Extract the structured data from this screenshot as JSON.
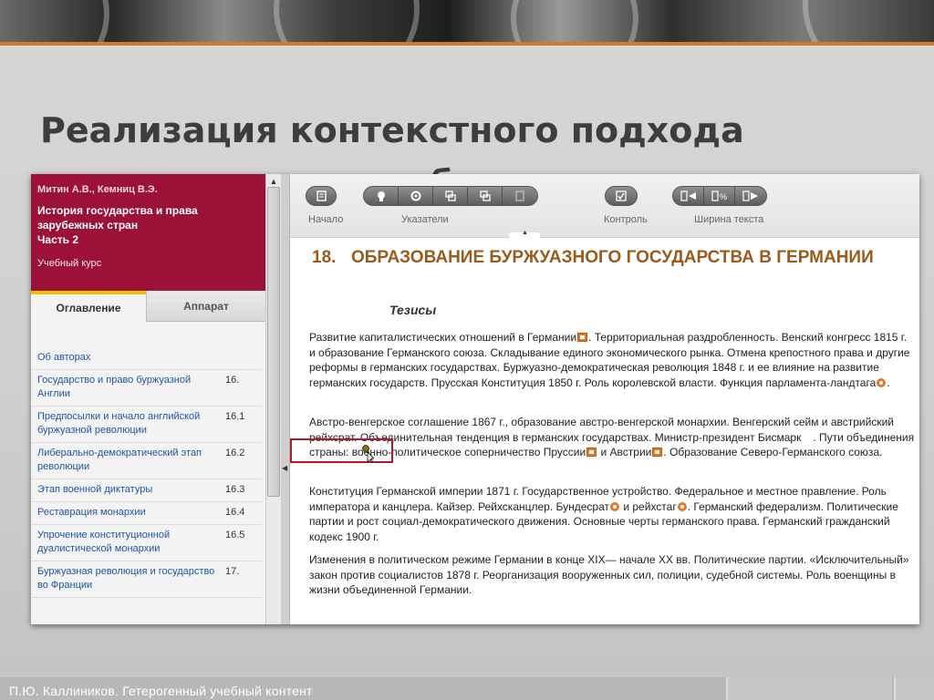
{
  "slide": {
    "title_line1": "Реализация контекстного подхода",
    "title_line2": "в электронных учебных курсах",
    "footer": "П.Ю. Каллиников. Гетерогенный учебный контент"
  },
  "course": {
    "authors": "Митин А.В., Кемниц В.Э.",
    "title_line1": "История государства и права",
    "title_line2": "зарубежных стран",
    "title_line3": "Часть 2",
    "kind": "Учебный курс",
    "accent_color": "#9b1137"
  },
  "tabs": {
    "contents": "Оглавление",
    "apparatus": "Аппарат"
  },
  "toc": [
    {
      "label": "Об авторах",
      "num": ""
    },
    {
      "label": "Государство и право буржуазной Англии",
      "num": "16."
    },
    {
      "label": "Предпосылки и начало английской буржуазной революции",
      "num": "16.1"
    },
    {
      "label": "Либерально-демократический этап революции",
      "num": "16.2"
    },
    {
      "label": "Этап военной диктатуры",
      "num": "16.3"
    },
    {
      "label": "Реставрация монархии",
      "num": "16.4"
    },
    {
      "label": "Упрочение конституционной дуалистической монархии",
      "num": "16.5"
    },
    {
      "label": "Буржуазная революция и государство во Франции",
      "num": "17."
    }
  ],
  "toolbar": {
    "start_label": "Начало",
    "pointers_label": "Указатели",
    "control_label": "Контроль",
    "width_label": "Ширина текста",
    "btn_home_icon": "page-icon",
    "btn_head_icon": "head-icon",
    "btn_gear_icon": "gear-icon",
    "btn_win1_icon": "windows-icon",
    "btn_win2_icon": "windows-icon",
    "btn_file_icon": "file-icon",
    "btn_check_icon": "check-icon",
    "btn_back_icon": "arrow-left-icon",
    "btn_percent_icon": "percent-icon",
    "btn_fwd_icon": "arrow-right-icon"
  },
  "article": {
    "number": "18.",
    "heading": "ОБРАЗОВАНИЕ БУРЖУАЗНОГО ГОСУДАРСТВА В ГЕРМАНИИ",
    "subheading": "Тезисы",
    "p1_a": "Развитие капиталистических отношений в Германии",
    "p1_b": ". Территориальная раздробленность. Венский конгресс 1815 г. и образование Германского союза. Складывание единого экономического рынка. Отмена крепостного права и другие реформы в германских государствах. Буржуазно-демократическая революция 1848 г. и ее влияние на развитие германских государств. Прусская Конституция 1850 г. Роль королевской власти. Функция парламента-ландтага",
    "p1_c": ".",
    "p2_a": "Австро-венгерское соглашение 1867 г., образование австро-венгерской монархии. Венгерский сейм и австрийский рейхсрат. Объединительная тенденция в германских государствах. Министр-президент Бисмарк",
    "p2_b": ". Пути объединения страны: военно-политическое соперничество Пруссии",
    "p2_c": " и Австрии",
    "p2_d": ". Образование Северо-Германского союза.",
    "p3_a": "Конституция Германской империи 1871 г. Государственное устройство. Федеральное и местное правление. Роль императора и канцлера. Кайзер. Рейхсканцлер. Бундесрат",
    "p3_b": " и рейхстаг",
    "p3_c": ". Германский федерализм. Политические партии и рост социал-демократического движения. Основные черты германского права. Германский гражданский кодекс 1900 г.",
    "p4": "Изменения в политическом режиме Германии в конце XIX— начале XX вв. Политические партии. «Исключительный» закон против социалистов 1878 г. Реорганизация вооруженных сил, полиции, судебной системы. Роль военщины в жизни объединенной Германии.",
    "heading_color": "#9a5b1c",
    "link_color": "#e07b21"
  }
}
